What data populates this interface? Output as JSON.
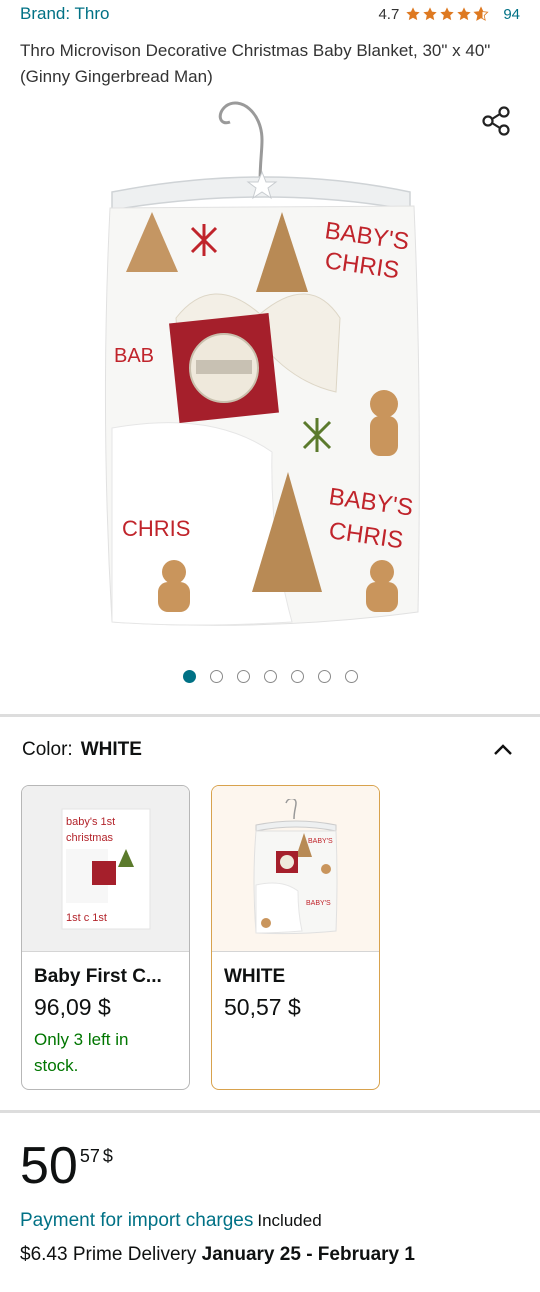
{
  "header": {
    "brand": "Brand: Thro",
    "rating_value": "4.7",
    "rating_count": "94",
    "rating_stars": 4.7
  },
  "product": {
    "title": "Thro Microvison Decorative Christmas Baby Blanket, 30\" x 40\" (Ginny Gingerbread Man)"
  },
  "icons": {
    "share": "share-icon",
    "chevron": "chevron-up-icon",
    "star": "star-icon"
  },
  "carousel": {
    "total_images": 7,
    "active_index": 0
  },
  "variation": {
    "label": "Color:",
    "selected_value": "WHITE",
    "options": [
      {
        "name": "Baby First C...",
        "price": "96,09 $",
        "stock": "Only 3 left in stock.",
        "selected": false
      },
      {
        "name": "WHITE",
        "price": "50,57 $",
        "stock": "",
        "selected": true
      }
    ]
  },
  "buybox": {
    "price_whole": "50",
    "price_fraction": "57",
    "currency": "$",
    "import_link": "Payment for import charges",
    "import_status": "Included",
    "delivery_price": "$6.43 Prime Delivery",
    "delivery_dates": "January 25 - February 1"
  },
  "colors": {
    "link": "#007185",
    "star": "#de7921",
    "stock": "#007600",
    "selected_border": "#d8a24d"
  }
}
